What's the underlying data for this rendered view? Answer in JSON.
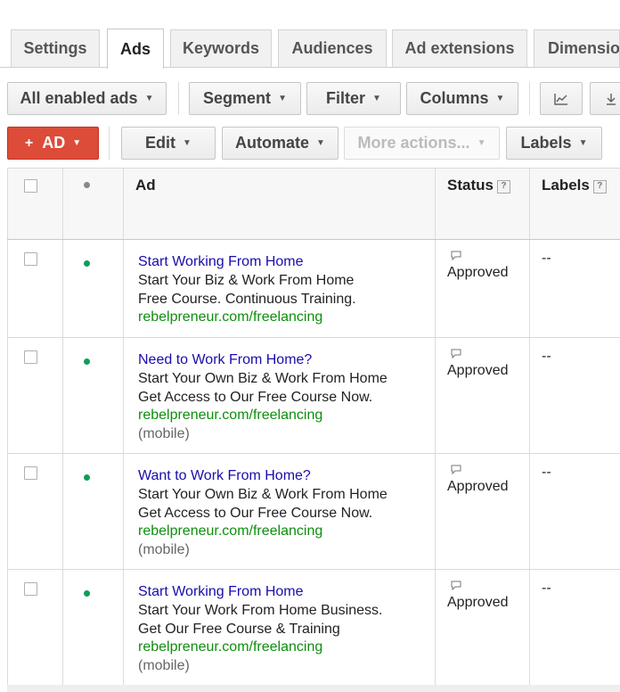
{
  "tabs": [
    {
      "label": "Settings",
      "active": false
    },
    {
      "label": "Ads",
      "active": true
    },
    {
      "label": "Keywords",
      "active": false
    },
    {
      "label": "Audiences",
      "active": false
    },
    {
      "label": "Ad extensions",
      "active": false
    },
    {
      "label": "Dimensions",
      "active": false
    }
  ],
  "toolbar1": {
    "filter_ads": "All enabled ads",
    "segment": "Segment",
    "filter": "Filter",
    "columns": "Columns",
    "chart_icon": "line-chart-icon",
    "download_icon": "download-icon"
  },
  "toolbar2": {
    "add_ad": "AD",
    "add_prefix": "+",
    "edit": "Edit",
    "automate": "Automate",
    "more_actions": "More actions...",
    "labels": "Labels"
  },
  "table": {
    "headers": {
      "status_dot": "•",
      "ad": "Ad",
      "status": "Status",
      "labels": "Labels",
      "help": "?"
    },
    "rows": [
      {
        "title": "Start Working From Home",
        "line1": "Start Your Biz & Work From Home",
        "line2": "Free Course. Continuous Training.",
        "url": "rebelpreneur.com/freelancing",
        "mobile": "",
        "status": "Approved",
        "labels": "--"
      },
      {
        "title": "Need to Work From Home?",
        "line1": "Start Your Own Biz & Work From Home",
        "line2": "Get Access to Our Free Course Now.",
        "url": "rebelpreneur.com/freelancing",
        "mobile": "(mobile)",
        "status": "Approved",
        "labels": "--"
      },
      {
        "title": "Want to Work From Home?",
        "line1": "Start Your Own Biz & Work From Home",
        "line2": "Get Access to Our Free Course Now.",
        "url": "rebelpreneur.com/freelancing",
        "mobile": "(mobile)",
        "status": "Approved",
        "labels": "--"
      },
      {
        "title": "Start Working From Home",
        "line1": "Start Your Work From Home Business.",
        "line2": "Get Our Free Course & Training",
        "url": "rebelpreneur.com/freelancing",
        "mobile": "(mobile)",
        "status": "Approved",
        "labels": "--"
      }
    ]
  },
  "colors": {
    "enabled_dot": "#0f9d58",
    "header_dot": "#888888",
    "title_link": "#1a0dab",
    "url_green": "#0e8e0e",
    "add_button": "#dd4b39"
  }
}
